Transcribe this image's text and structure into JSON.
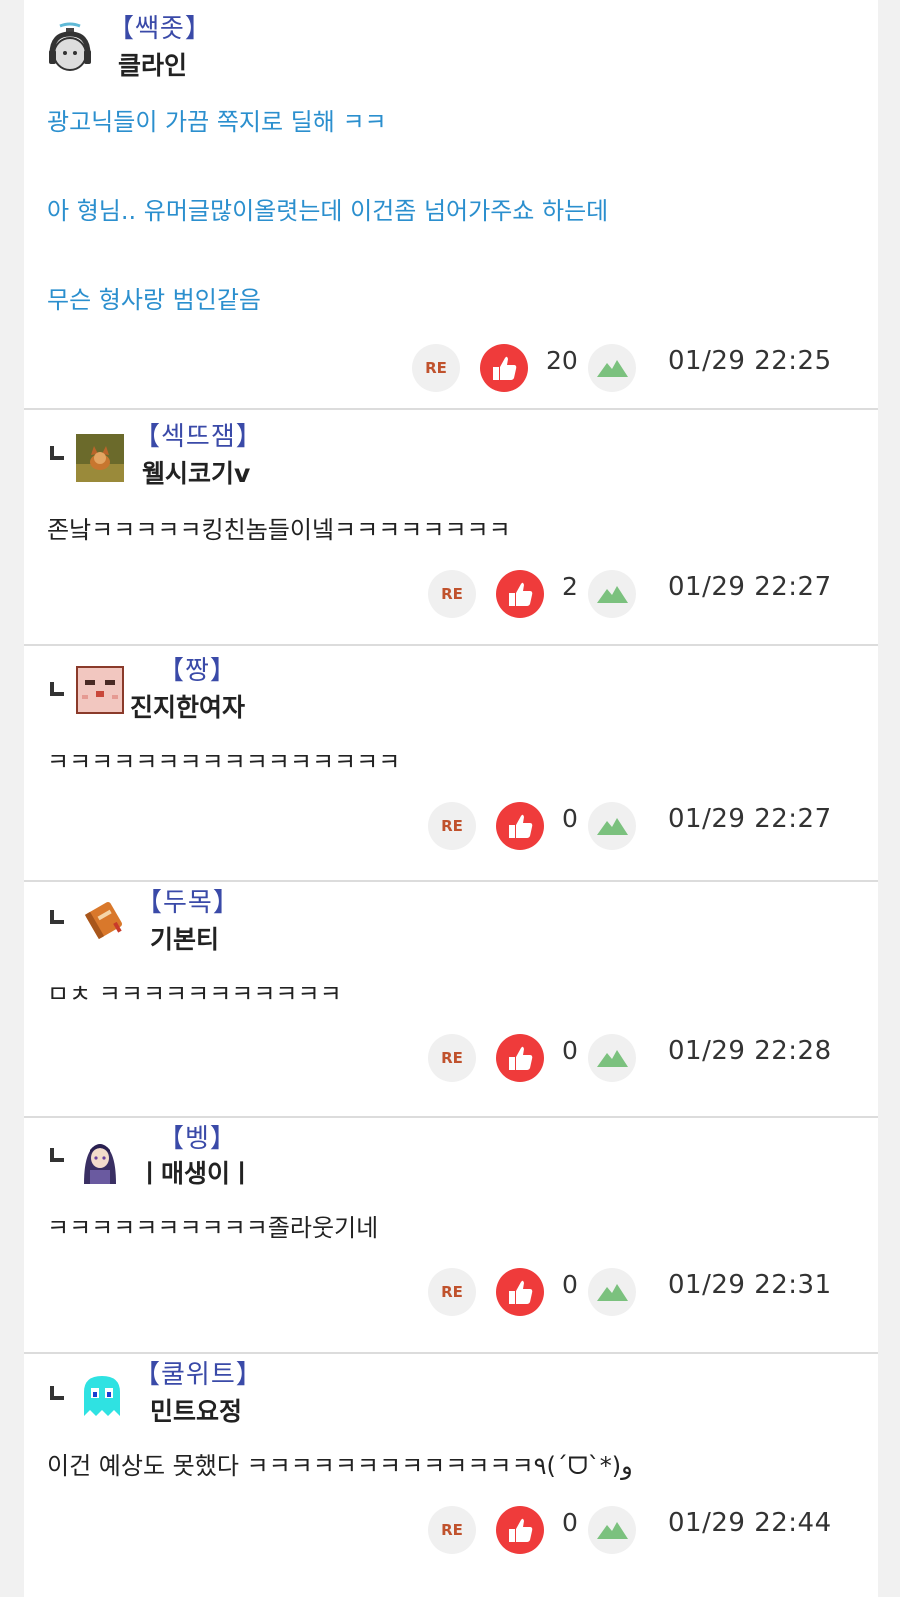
{
  "comments": [
    {
      "tag": "【쌕좃】",
      "nick": "클라인",
      "lines": [
        "광고닉들이 가끔 쪽지로 딜해 ㅋㅋ",
        "아 형님.. 유머글많이올렷는데 이건좀 넘어가주쇼 하는데",
        "무슨 형사랑 범인같음"
      ],
      "re": "RE",
      "likes": "20",
      "time": "01/29 22:25",
      "avatar": "headset-avatar"
    },
    {
      "tag": "【섹뜨잼】",
      "nick": "웰시코기v",
      "lines": [
        "존낰ㅋㅋㅋㅋㅋ킹친놈들이넼ㅋㅋㅋㅋㅋㅋㅋㅋ"
      ],
      "re": "RE",
      "likes": "2",
      "time": "01/29 22:27",
      "avatar": "dog-avatar"
    },
    {
      "tag": "【짱】",
      "nick": "진지한여자",
      "lines": [
        "ㅋㅋㅋㅋㅋㅋㅋㅋㅋㅋㅋㅋㅋㅋㅋㅋ"
      ],
      "re": "RE",
      "likes": "0",
      "time": "01/29 22:27",
      "avatar": "pixel-face-avatar"
    },
    {
      "tag": "【두목】",
      "nick": "기본티",
      "lines": [
        "ㅁㅊ ㅋㅋㅋㅋㅋㅋㅋㅋㅋㅋㅋ"
      ],
      "re": "RE",
      "likes": "0",
      "time": "01/29 22:28",
      "avatar": "book-avatar"
    },
    {
      "tag": "【벵】",
      "nick": "ㅣ매생이ㅣ",
      "lines": [
        "ㅋㅋㅋㅋㅋㅋㅋㅋㅋㅋ졸라웃기네"
      ],
      "re": "RE",
      "likes": "0",
      "time": "01/29 22:31",
      "avatar": "anime-avatar"
    },
    {
      "tag": "【쿨위트】",
      "nick": "민트요정",
      "lines": [
        "이건 예상도 못했다 ㅋㅋㅋㅋㅋㅋㅋㅋㅋㅋㅋㅋㅋ٩(´ᗜ`*)و"
      ],
      "re": "RE",
      "likes": "0",
      "time": "01/29 22:44",
      "avatar": "ghost-avatar"
    }
  ],
  "colors": {
    "tag": "#3a4aa8",
    "first_comment_text": "#2b8fce",
    "like": "#ef3b3b",
    "re_text": "#c0522d",
    "mountain": "#7bc17e"
  },
  "icons": {
    "like": "thumbs-up-icon",
    "image": "mountain-icon",
    "reply_mark": "reply-indent-icon"
  }
}
